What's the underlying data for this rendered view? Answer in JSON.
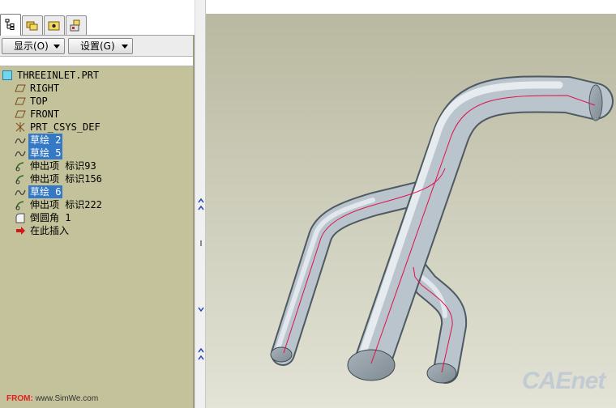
{
  "model_tree": {
    "toolbar": {
      "show_button": "显示(O)",
      "settings_button": "设置(G)"
    },
    "tabs": [
      {
        "icon": "model-tree-icon",
        "active": true
      },
      {
        "icon": "folder-browser-icon",
        "active": false
      },
      {
        "icon": "favorites-icon",
        "active": false
      },
      {
        "icon": "connections-icon",
        "active": false
      }
    ],
    "root": {
      "label": "THREEINLET.PRT",
      "icon": "part-icon"
    },
    "items": [
      {
        "label": "RIGHT",
        "icon": "datum-plane-icon",
        "selected": false
      },
      {
        "label": "TOP",
        "icon": "datum-plane-icon",
        "selected": false
      },
      {
        "label": "FRONT",
        "icon": "datum-plane-icon",
        "selected": false
      },
      {
        "label": "PRT_CSYS_DEF",
        "icon": "coordinate-system-icon",
        "selected": false
      },
      {
        "label": "草绘 2",
        "icon": "sketch-icon",
        "selected": true
      },
      {
        "label": "草绘 5",
        "icon": "sketch-icon",
        "selected": true
      },
      {
        "label": "伸出项 标识93",
        "icon": "protrusion-icon",
        "selected": false
      },
      {
        "label": "伸出项 标识156",
        "icon": "protrusion-icon",
        "selected": false
      },
      {
        "label": "草绘 6",
        "icon": "sketch-icon",
        "selected": true
      },
      {
        "label": "伸出项 标识222",
        "icon": "protrusion-icon",
        "selected": false
      },
      {
        "label": "倒圆角 1",
        "icon": "round-icon",
        "selected": false
      },
      {
        "label": "在此插入",
        "icon": "insert-here-arrow-icon",
        "selected": false
      }
    ]
  },
  "watermark": {
    "from_label": "FROM:",
    "from_url": "www.SimWe.com",
    "logo_text": "CAEnet"
  },
  "colors": {
    "tree_background": "#c3c29a",
    "selection": "#3478c6",
    "viewport_gradient_top": "#b9b9a1",
    "viewport_gradient_bottom": "#e3e3d6",
    "model_surface": "#b9c4cd",
    "sketch_curve": "#e0104a"
  }
}
